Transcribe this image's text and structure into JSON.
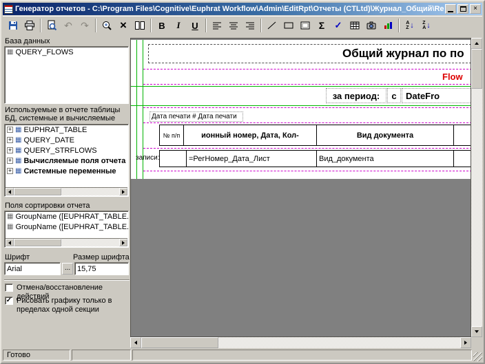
{
  "window": {
    "title": "Генератор отчетов - C:\\Program Files\\Cognitive\\Euphrat Workflow\\Admin\\EditRpt\\Отчеты (CTLtd)\\Журнал_Общий\\Repor...",
    "close_glyph": "×"
  },
  "toolbar": {
    "glyphs": {
      "undo": "↶",
      "redo": "↷",
      "delete": "×",
      "bold": "B",
      "italic": "I",
      "underline": "U",
      "sum": "Σ",
      "check": "✓"
    },
    "sort": {
      "a": "A",
      "z": "Z",
      "arrow": "↓"
    }
  },
  "sidebar": {
    "database_label": "База данных",
    "database_items": [
      {
        "label": "QUERY_FLOWS"
      }
    ],
    "tables_label": "Используемые в отчете таблицы БД, системные и вычисляемые переменные",
    "plus_glyph": "+",
    "table_icon_glyph": "▦",
    "tables_tree": [
      {
        "label": "EUPHRAT_TABLE"
      },
      {
        "label": "QUERY_DATE"
      },
      {
        "label": "QUERY_STRFLOWS"
      },
      {
        "label": "Вычисляемые поля отчета"
      },
      {
        "label": "Системные переменные"
      }
    ],
    "sort_label": "Поля сортировки отчета",
    "sort_items": [
      {
        "label": "GroupName ([EUPHRAT_TABLE.Дог"
      },
      {
        "label": "GroupName ([EUPHRAT_TABLE.Рег"
      }
    ],
    "font_label": "Шрифт",
    "font_size_label": "Размер шрифта",
    "font_value": "Arial",
    "font_browse": "...",
    "font_size_value": "15,75",
    "undo_checkbox_label": "Отмена/восстановление действий",
    "clip_checkbox_label": "Рисовать графику только в пределах одной секции",
    "clip_check_glyph": "✓"
  },
  "report": {
    "title": "Общий журнал по по",
    "flow": "Flow",
    "period_label": "за период:",
    "period_from_label": "с",
    "period_from_field": "DateFro",
    "print_date": "Дата печати # Дата печати",
    "header": {
      "col1": "№ п/п",
      "col2": "ионный номер, Дата, Кол-",
      "col3": "Вид документа"
    },
    "row": {
      "prefix": "записи:",
      "col2": "=РегНомер_Дата_Лист",
      "col3": "Вид_документа"
    }
  },
  "statusbar": {
    "ready": "Готово"
  },
  "colors": {
    "title_gradient_start": "#0a246a",
    "title_gradient_end": "#a6caf0",
    "grid_green": "#00b400",
    "band_magenta": "#cc00cc",
    "flow_red": "#dd0000"
  }
}
